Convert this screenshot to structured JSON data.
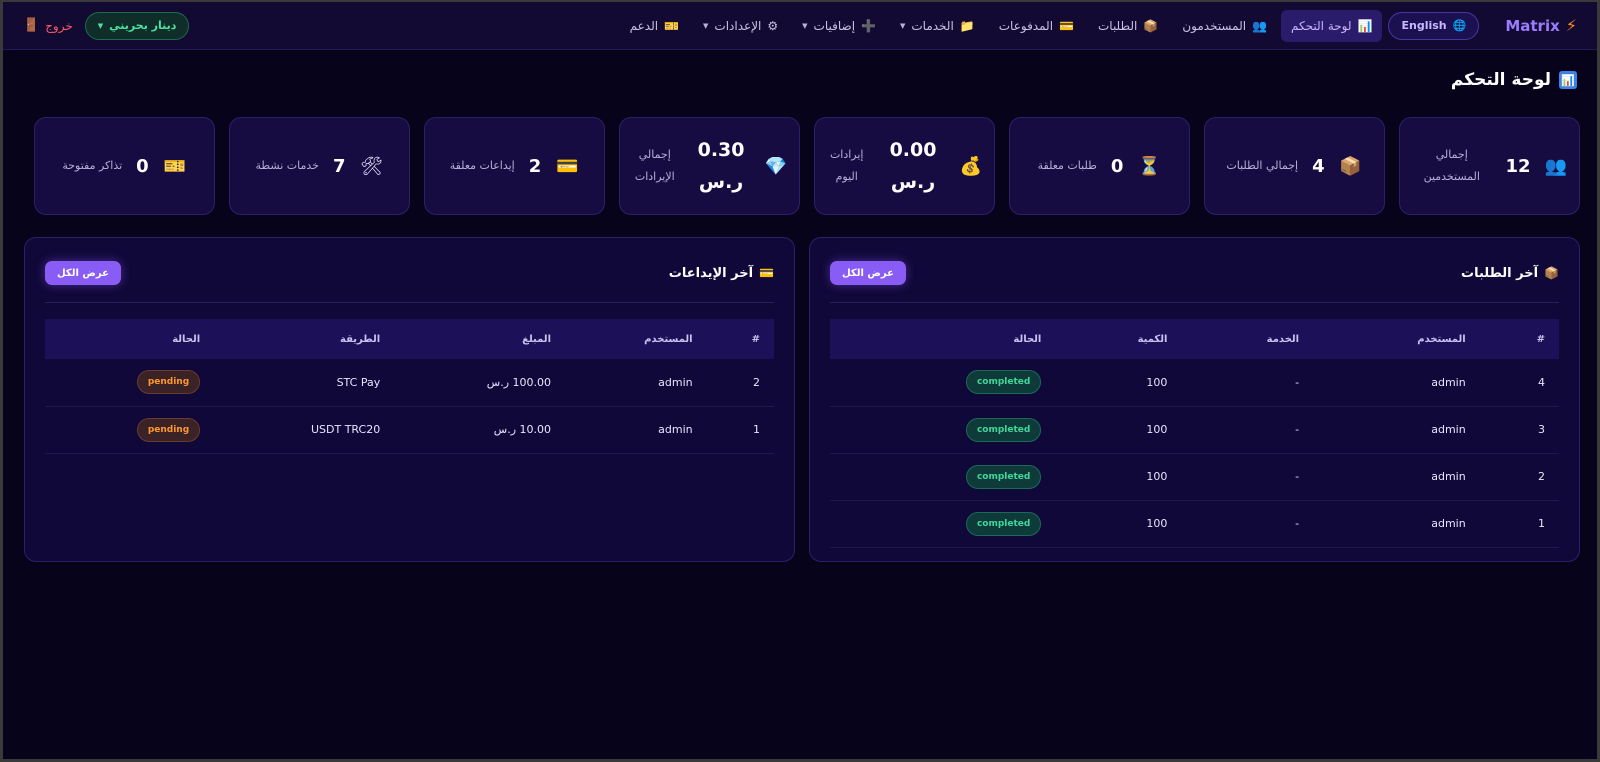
{
  "brand": {
    "name": "Matrix"
  },
  "lang_button": {
    "label": "English"
  },
  "nav": {
    "items": [
      {
        "key": "dashboard",
        "label": "لوحة التحكم",
        "icon": "📊",
        "active": true,
        "has_caret": false
      },
      {
        "key": "users",
        "label": "المستخدمون",
        "icon": "👥",
        "active": false,
        "has_caret": false
      },
      {
        "key": "orders",
        "label": "الطلبات",
        "icon": "📦",
        "active": false,
        "has_caret": false
      },
      {
        "key": "payments",
        "label": "المدفوعات",
        "icon": "💳",
        "active": false,
        "has_caret": false
      },
      {
        "key": "services",
        "label": "الخدمات",
        "icon": "📁",
        "active": false,
        "has_caret": true
      },
      {
        "key": "extras",
        "label": "إضافيات",
        "icon": "➕",
        "active": false,
        "has_caret": true
      },
      {
        "key": "settings",
        "label": "الإعدادات",
        "icon": "⚙",
        "active": false,
        "has_caret": true
      },
      {
        "key": "support",
        "label": "الدعم",
        "icon": "🎫",
        "active": false,
        "has_caret": false
      }
    ]
  },
  "currency_button": {
    "label": "دينار بحريني"
  },
  "logout": {
    "label": "خروج"
  },
  "page_title": "لوحة التحكم",
  "stats": [
    {
      "key": "users",
      "icon": "👥",
      "value": "12",
      "label": "إجمالي المستخدمين"
    },
    {
      "key": "orders",
      "icon": "📦",
      "value": "4",
      "label": "إجمالي الطلبات"
    },
    {
      "key": "pending-orders",
      "icon": "⏳",
      "value": "0",
      "label": "طلبات معلقة"
    },
    {
      "key": "today-revenue",
      "icon": "💰",
      "value": "0.00 ر.س",
      "label": "إيرادات اليوم"
    },
    {
      "key": "total-revenue",
      "icon": "💎",
      "value": "0.30 ر.س",
      "label": "إجمالي الإيرادات"
    },
    {
      "key": "pending-deposits",
      "icon": "💳",
      "value": "2",
      "label": "إيداعات معلقة"
    },
    {
      "key": "active-services",
      "icon": "🛠",
      "value": "7",
      "label": "خدمات نشطة"
    },
    {
      "key": "open-tickets",
      "icon": "🎫",
      "value": "0",
      "label": "تذاكر مفتوحة"
    }
  ],
  "orders_panel": {
    "title": "آخر الطلبات",
    "view_all": "عرض الكل",
    "columns": [
      "#",
      "المستخدم",
      "الخدمة",
      "الكمية",
      "الحالة"
    ],
    "rows": [
      {
        "id": "4",
        "user": "admin",
        "service": "-",
        "qty": "100",
        "status": "completed"
      },
      {
        "id": "3",
        "user": "admin",
        "service": "-",
        "qty": "100",
        "status": "completed"
      },
      {
        "id": "2",
        "user": "admin",
        "service": "-",
        "qty": "100",
        "status": "completed"
      },
      {
        "id": "1",
        "user": "admin",
        "service": "-",
        "qty": "100",
        "status": "completed"
      }
    ]
  },
  "deposits_panel": {
    "title": "آخر الإيداعات",
    "view_all": "عرض الكل",
    "columns": [
      "#",
      "المستخدم",
      "المبلغ",
      "الطريقة",
      "الحالة"
    ],
    "rows": [
      {
        "id": "2",
        "user": "admin",
        "amount": "100.00 ر.س",
        "method": "STC Pay",
        "status": "pending"
      },
      {
        "id": "1",
        "user": "admin",
        "amount": "10.00 ر.س",
        "method": "USDT TRC20",
        "status": "pending"
      }
    ]
  }
}
